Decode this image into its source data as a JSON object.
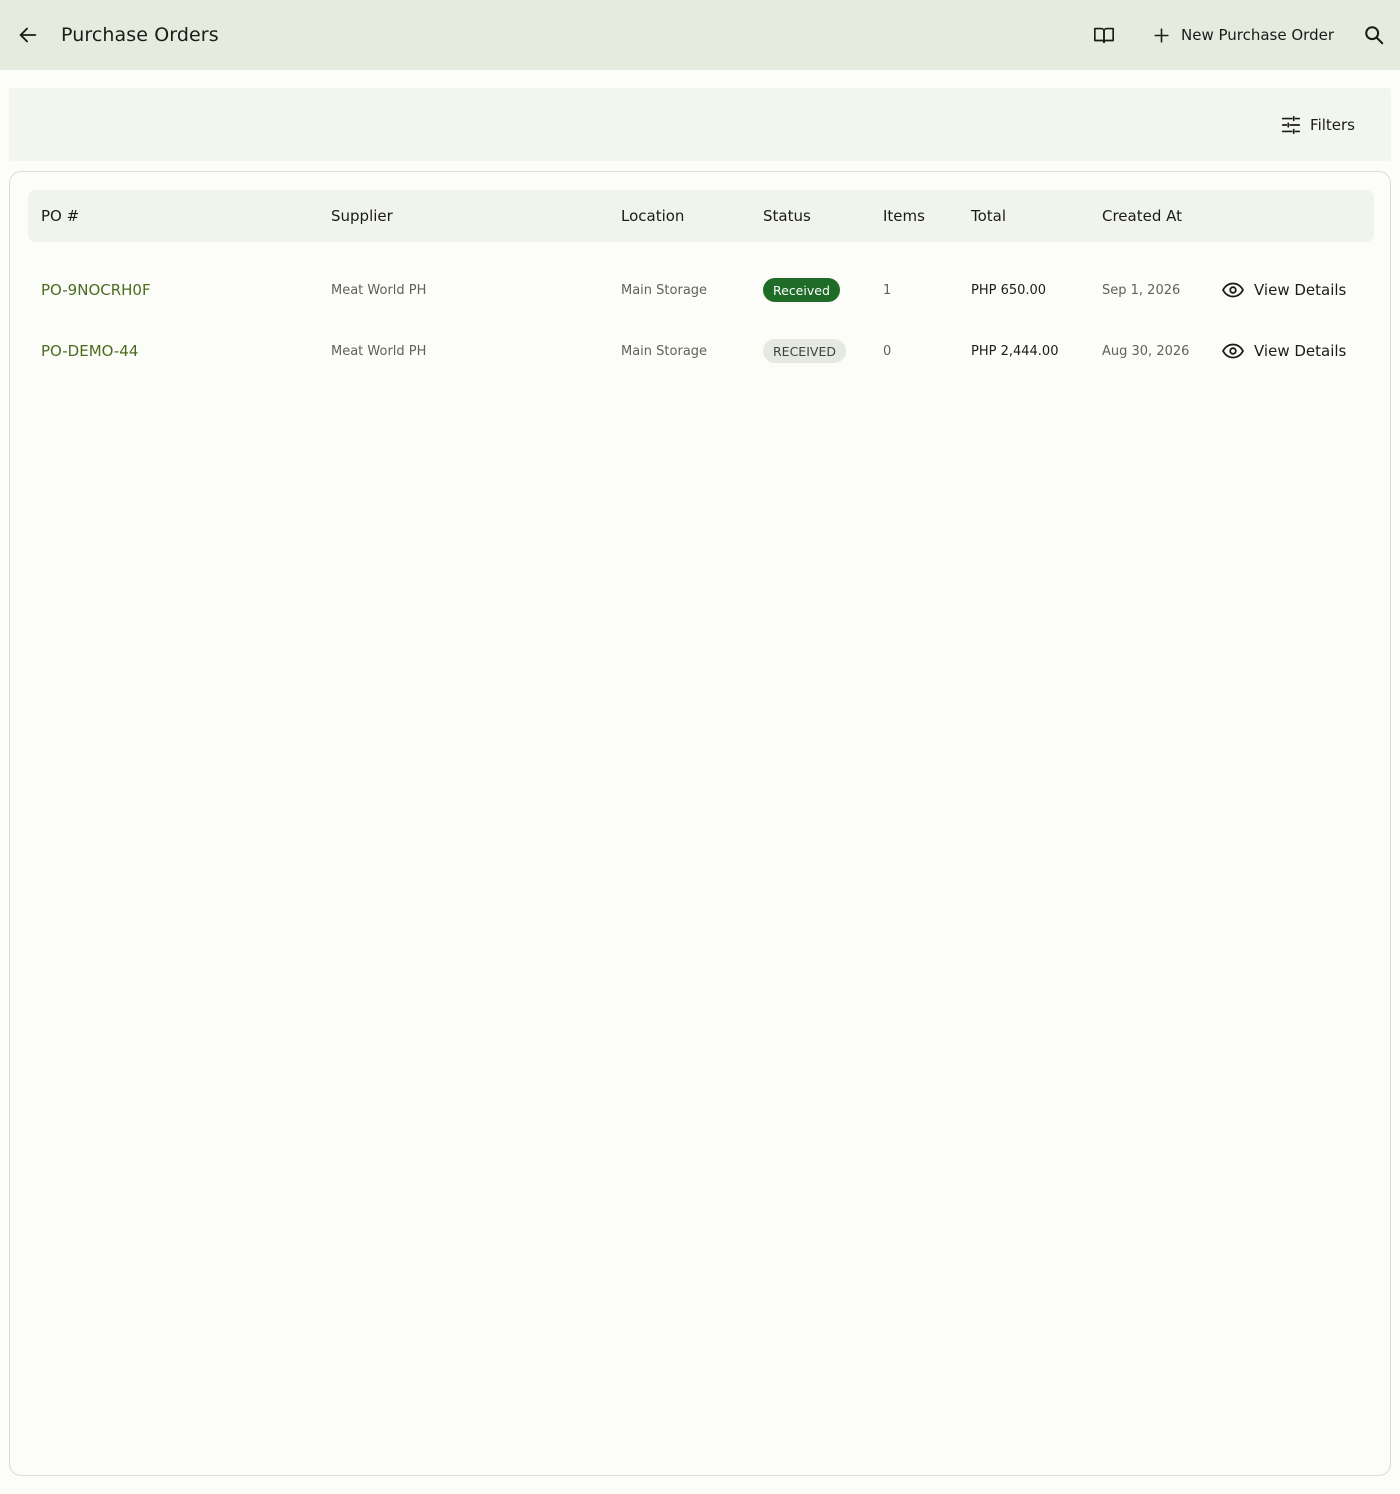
{
  "appbar": {
    "title": "Purchase Orders",
    "new_button_label": "New Purchase Order",
    "icons": {
      "back": "arrow-left-icon",
      "guide": "book-open-icon",
      "add": "plus-icon",
      "search": "search-icon"
    }
  },
  "filters": {
    "label": "Filters",
    "icon": "sliders-icon"
  },
  "table": {
    "columns": [
      "PO #",
      "Supplier",
      "Location",
      "Status",
      "Items",
      "Total",
      "Created At"
    ],
    "rows": [
      {
        "po_number": "PO-9NOCRH0F",
        "supplier": "Meat World PH",
        "location": "Main Storage",
        "status": "Received",
        "items": "1",
        "total": "PHP 650.00",
        "created_at": "Sep 1, 2026",
        "action": "View Details"
      },
      {
        "po_number": "PO-DEMO-44",
        "supplier": "Meat World PH",
        "location": "Main Storage",
        "status": "RECEIVED",
        "items": "0",
        "total": "PHP 2,444.00",
        "created_at": "Aug 30, 2026",
        "action": "View Details"
      }
    ]
  },
  "colors": {
    "appbar_bg": "#e6ebdf",
    "link": "#4c6b1f",
    "status_received": "#1f6b28",
    "status_received_upper_bg": "#e5e9df"
  }
}
